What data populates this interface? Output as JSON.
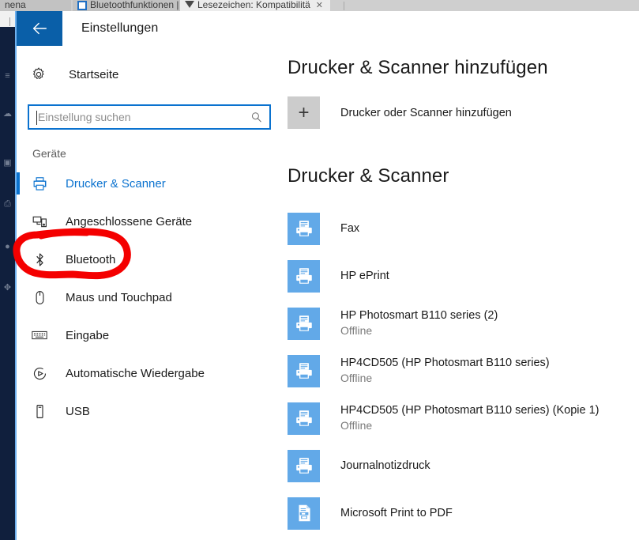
{
  "browser": {
    "tabs": [
      {
        "label": "Bluetoothfunktionen | Wi...",
        "favicon": "bluetooth-page-icon",
        "close": "✕",
        "active": false
      },
      {
        "label": "Lesezeichen: Kompatibilitä",
        "favicon": "bookmark-page-icon",
        "close": "✕",
        "active": true
      }
    ]
  },
  "window": {
    "title": "Einstellungen",
    "back_icon": "back-arrow-icon",
    "accent": "#0a5fa8"
  },
  "nav": {
    "home": {
      "label": "Startseite",
      "icon": "gear-icon"
    },
    "search": {
      "value": "",
      "placeholder": "Einstellung suchen",
      "icon": "search-icon"
    },
    "section": "Geräte",
    "items": [
      {
        "label": "Drucker & Scanner",
        "icon": "printer-icon",
        "selected": true
      },
      {
        "label": "Angeschlossene Geräte",
        "icon": "connected-devices-icon",
        "selected": false
      },
      {
        "label": "Bluetooth",
        "icon": "bluetooth-icon",
        "selected": false
      },
      {
        "label": "Maus und Touchpad",
        "icon": "mouse-icon",
        "selected": false
      },
      {
        "label": "Eingabe",
        "icon": "keyboard-icon",
        "selected": false
      },
      {
        "label": "Automatische Wiedergabe",
        "icon": "autoplay-icon",
        "selected": false
      },
      {
        "label": "USB",
        "icon": "usb-icon",
        "selected": false
      }
    ]
  },
  "main": {
    "add_heading": "Drucker & Scanner hinzufügen",
    "add_button_label": "Drucker oder Scanner hinzufügen",
    "add_button_icon": "plus-icon",
    "list_heading": "Drucker & Scanner",
    "devices": [
      {
        "name": "Fax",
        "status": "",
        "icon": "printer-tile-icon"
      },
      {
        "name": "HP ePrint",
        "status": "",
        "icon": "printer-tile-icon"
      },
      {
        "name": "HP Photosmart B110 series (2)",
        "status": "Offline",
        "icon": "printer-tile-icon"
      },
      {
        "name": "HP4CD505 (HP Photosmart B110 series)",
        "status": "Offline",
        "icon": "printer-tile-icon"
      },
      {
        "name": "HP4CD505 (HP Photosmart B110 series) (Kopie 1)",
        "status": "Offline",
        "icon": "printer-tile-icon"
      },
      {
        "name": "Journalnotizdruck",
        "status": "",
        "icon": "printer-tile-icon"
      },
      {
        "name": "Microsoft Print to PDF",
        "status": "",
        "icon": "pdf-printer-tile-icon"
      }
    ]
  },
  "annotation": {
    "shape": "hand-drawn-red-ellipse",
    "target": "Bluetooth",
    "color": "#f40000"
  }
}
